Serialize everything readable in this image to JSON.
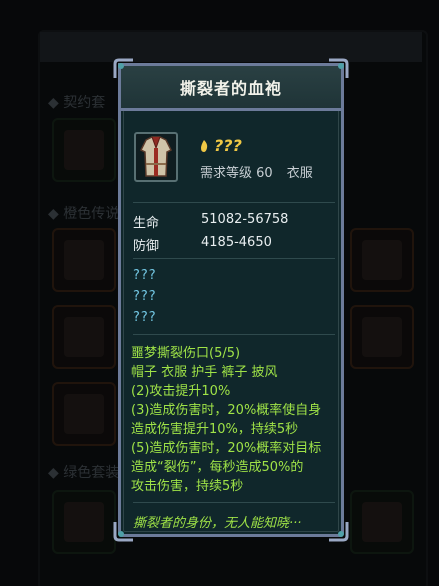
{
  "tooltip": {
    "title": "撕裂者的血袍",
    "rarity": "???",
    "level_req": "需求等级 60",
    "item_type": "衣服",
    "stats": [
      {
        "label": "生命",
        "value": "51082-56758"
      },
      {
        "label": "防御",
        "value": "4185-4650"
      }
    ],
    "unknown_lines": [
      "???",
      "???",
      "???"
    ],
    "set": {
      "name": "噩梦撕裂伤口(5/5)",
      "pieces": "帽子 衣服 护手 裤子 披风",
      "bonuses": [
        "(2)攻击提升10%",
        "(3)造成伤害时，20%概率使自身",
        "造成伤害提升10%，持续5秒",
        "(5)造成伤害时，20%概率对目标",
        "造成“裂伤”，每秒造成50%的",
        "攻击伤害，持续5秒"
      ]
    },
    "flavor": "撕裂者的身份，无人能知晓···"
  },
  "background": {
    "section_1": "◆ 契约套",
    "section_2": "◆ 橙色传说",
    "section_3": "◆ 绿色套装"
  },
  "colors": {
    "set_text": "#9fe347",
    "unknown_text": "#72c6e2",
    "rarity": "#f0c845",
    "frame": "#6c7b9a"
  }
}
